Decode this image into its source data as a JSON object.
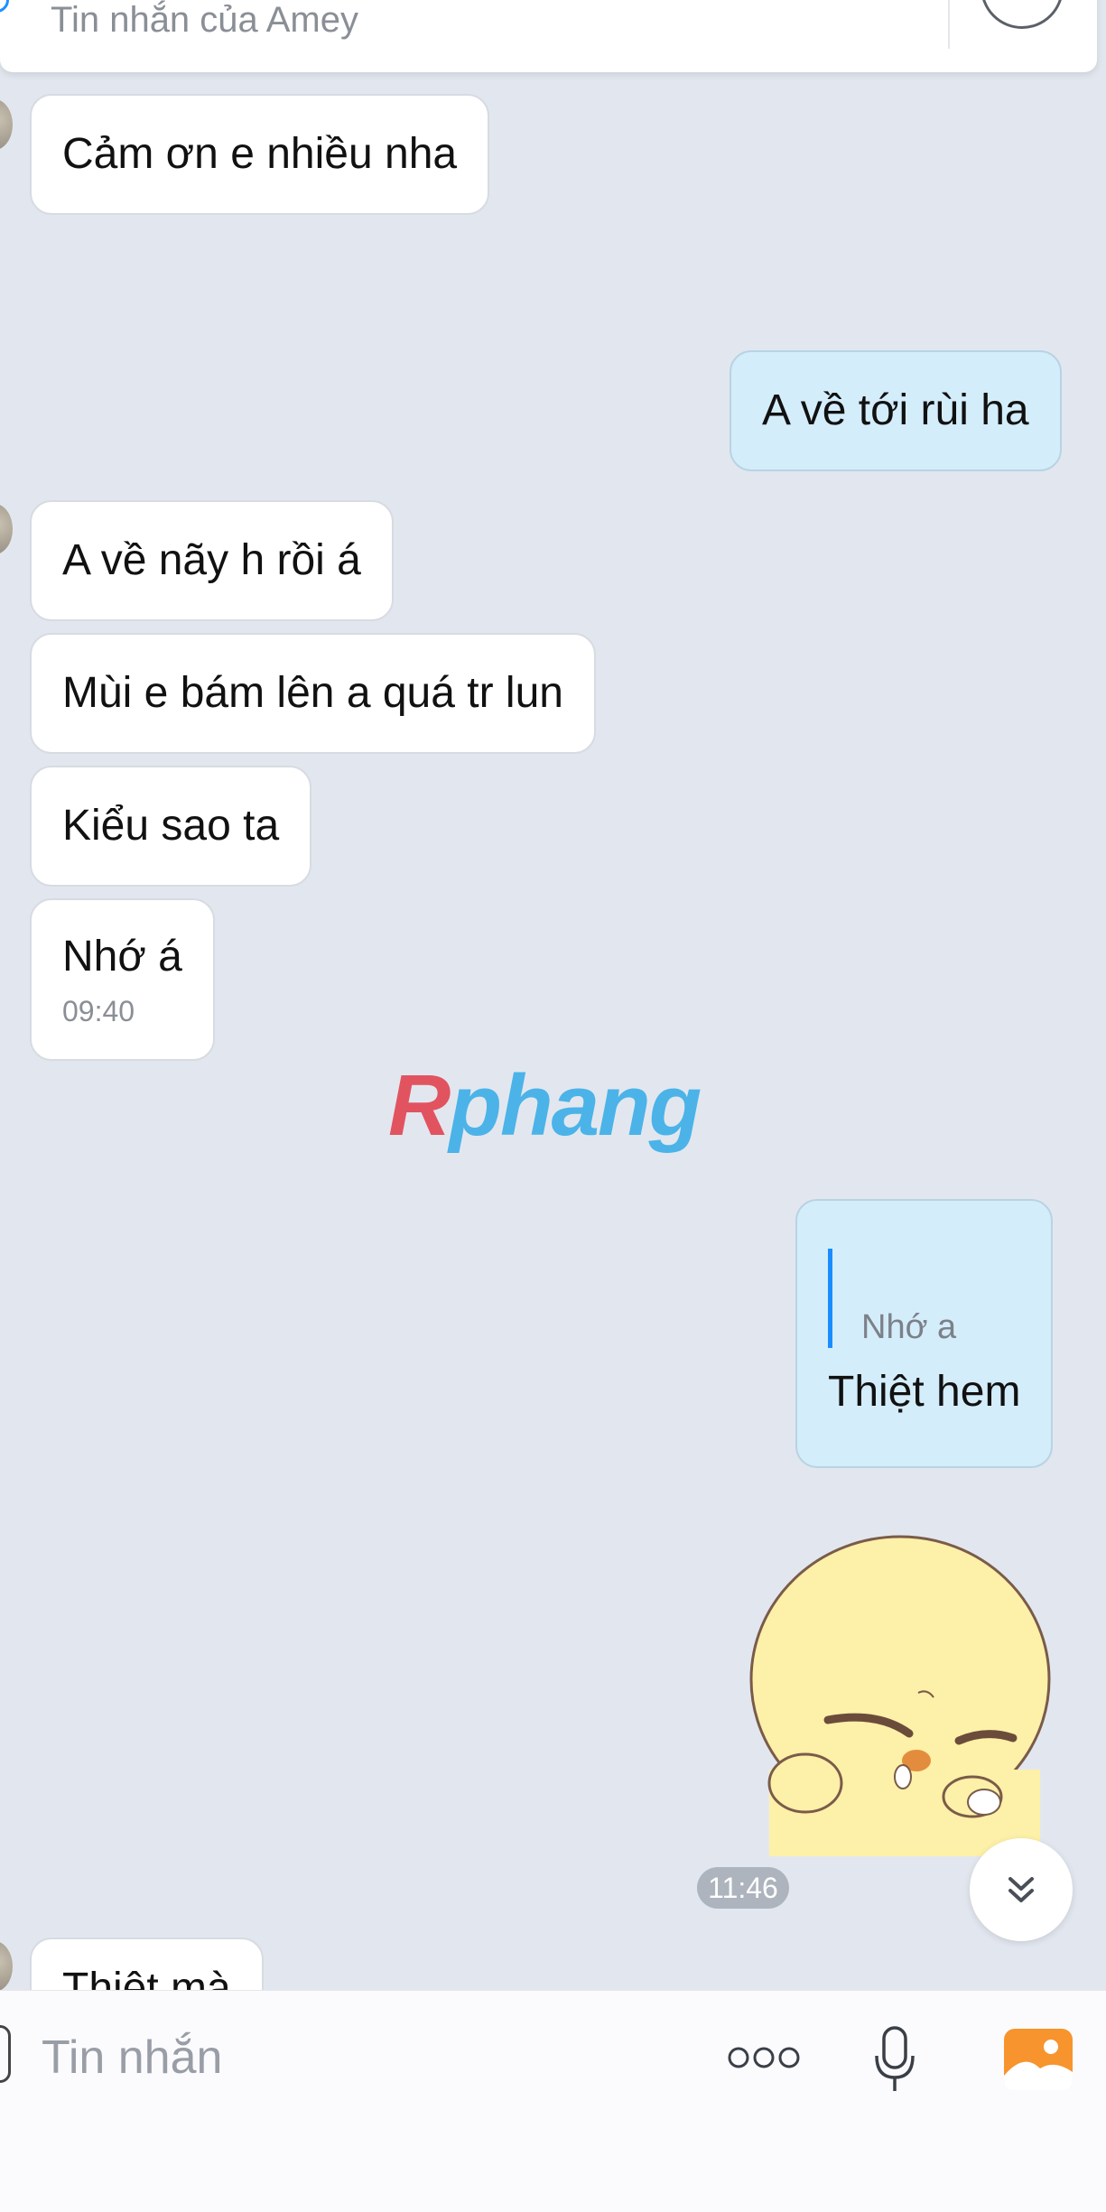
{
  "header": {
    "placeholder": "Tin nhắn của Amey"
  },
  "messages": [
    {
      "from": "them",
      "text": "Cảm ơn e nhiều nha"
    },
    {
      "from": "me",
      "text": "A về tới rùi ha"
    },
    {
      "from": "them",
      "text": "A về nãy h rồi á"
    },
    {
      "from": "them",
      "text": "Mùi e bám lên a quá tr lun"
    },
    {
      "from": "them",
      "text": "Kiểu sao ta"
    },
    {
      "from": "them",
      "text": "Nhớ á",
      "time": "09:40"
    },
    {
      "from": "me",
      "quote": "Nhớ a",
      "text": "Thiệt hem"
    },
    {
      "from": "me",
      "type": "sticker",
      "time": "11:46"
    },
    {
      "from": "them",
      "text": "Thiệt mà"
    }
  ],
  "watermark": {
    "part1": "R",
    "part2": "phang"
  },
  "composer": {
    "placeholder": "Tin nhắn",
    "icons": [
      "more-icon",
      "mic-icon",
      "image-icon"
    ]
  },
  "colors": {
    "background": "#e2e7ef",
    "my_bubble": "#d4edfa",
    "their_bubble": "#ffffff",
    "accent": "#1a8cff",
    "image_icon": "#f7942d"
  }
}
